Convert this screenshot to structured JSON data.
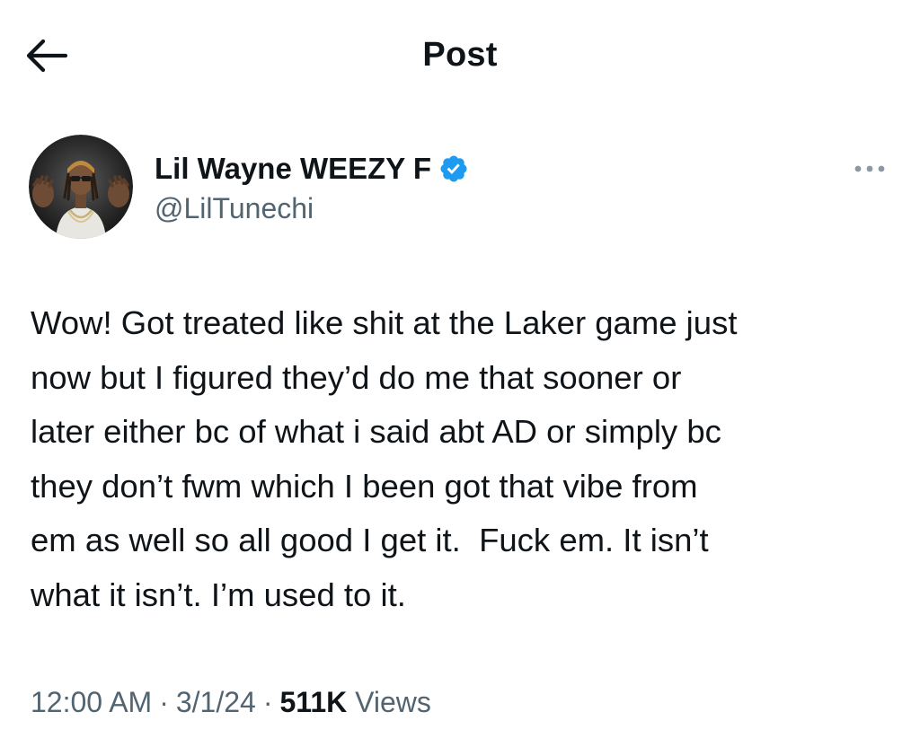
{
  "header": {
    "title": "Post",
    "back_icon": "arrow-left-icon"
  },
  "author": {
    "display_name": "Lil Wayne WEEZY F",
    "handle": "@LilTunechi",
    "verified": true,
    "verified_color": "#1d9bf0",
    "avatar_icon": "profile-photo",
    "more_icon": "more-horizontal-icon"
  },
  "post": {
    "lines": [
      "Wow! Got treated like shit at the Laker game just",
      "now but I figured they’d do me that sooner or",
      "later either bc of what i said abt AD or simply bc",
      "they don’t fwm which I been got that vibe from",
      "em as well so all good I get it.  Fuck em. It isn’t",
      "what it isn’t. I’m used to it."
    ],
    "time": "12:00 AM",
    "date": "3/1/24",
    "separator": "·",
    "views_count": "511K",
    "views_label": "Views"
  },
  "colors": {
    "text_primary": "#0f1419",
    "text_secondary": "#536471",
    "accent": "#1d9bf0",
    "background": "#ffffff"
  }
}
